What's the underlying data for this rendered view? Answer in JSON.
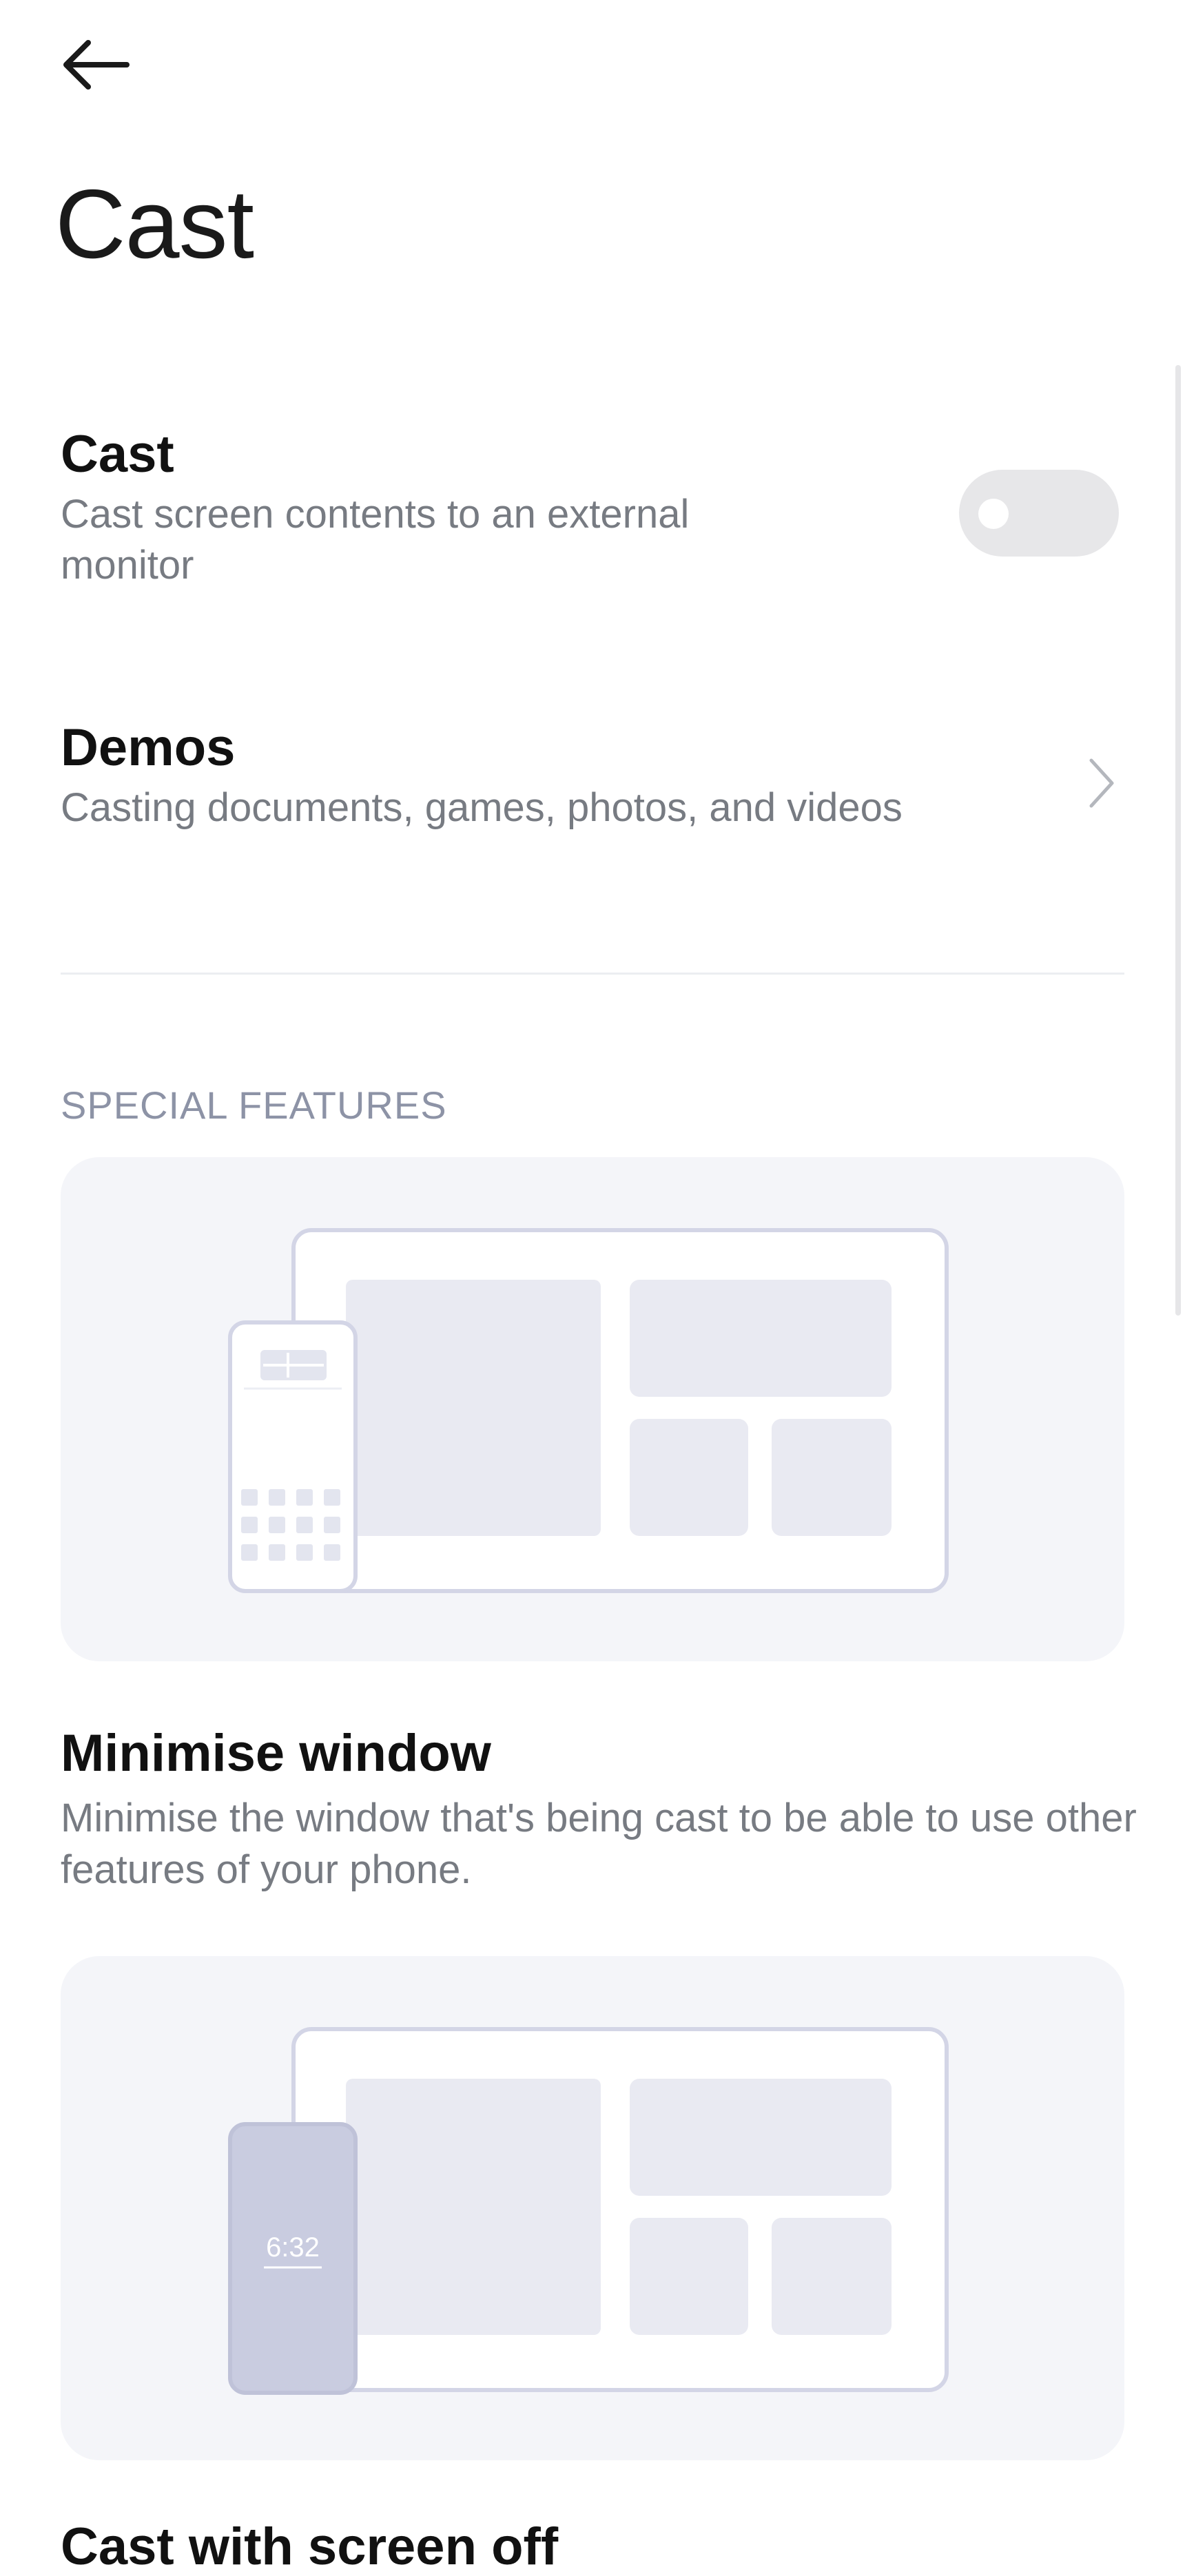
{
  "header": {
    "back_icon": "arrow-left-icon",
    "title": "Cast"
  },
  "settings": {
    "cast": {
      "title": "Cast",
      "subtitle": "Cast screen contents to an external monitor",
      "toggle_on": false
    },
    "demos": {
      "title": "Demos",
      "subtitle": "Casting documents, games, photos, and videos",
      "chevron_icon": "chevron-right-icon"
    }
  },
  "special_features": {
    "header": "SPECIAL FEATURES",
    "items": [
      {
        "title": "Minimise window",
        "description": "Minimise the window that's being cast to be able to use other features of your phone."
      },
      {
        "title": "Cast with screen off",
        "phone_time": "6:32"
      }
    ]
  },
  "colors": {
    "illustration_stroke": "#d3d5e6",
    "illustration_fill": "#e9eaf2",
    "card_background": "#f4f5f9",
    "phone_screen_off": "#c9cce0"
  }
}
